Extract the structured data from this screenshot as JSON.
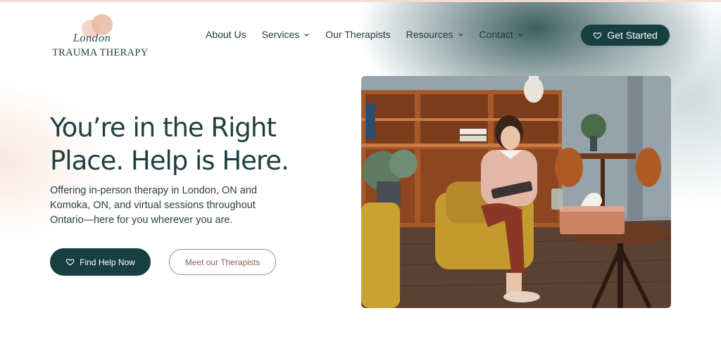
{
  "brand": {
    "script": "London",
    "wordmark": "TRAUMA THERAPY"
  },
  "nav": {
    "items": [
      {
        "label": "About Us",
        "dropdown": false
      },
      {
        "label": "Services",
        "dropdown": true
      },
      {
        "label": "Our Therapists",
        "dropdown": false
      },
      {
        "label": "Resources",
        "dropdown": true
      },
      {
        "label": "Contact",
        "dropdown": true
      }
    ],
    "cta": "Get Started"
  },
  "hero": {
    "title": "You’re in the Right Place. Help is Here.",
    "subtitle": "Offering in-person therapy in London, ON and Komoka, ON, and virtual sessions throughout Ontario—here for you wherever you are.",
    "primary_button": "Find Help Now",
    "secondary_button": "Meet our Therapists"
  },
  "colors": {
    "primary": "#173f42",
    "accent": "#b2887c",
    "logo_blob": "#e9b8a3"
  },
  "icons": {
    "cta": "heart-icon",
    "dropdown": "chevron-down-icon"
  }
}
